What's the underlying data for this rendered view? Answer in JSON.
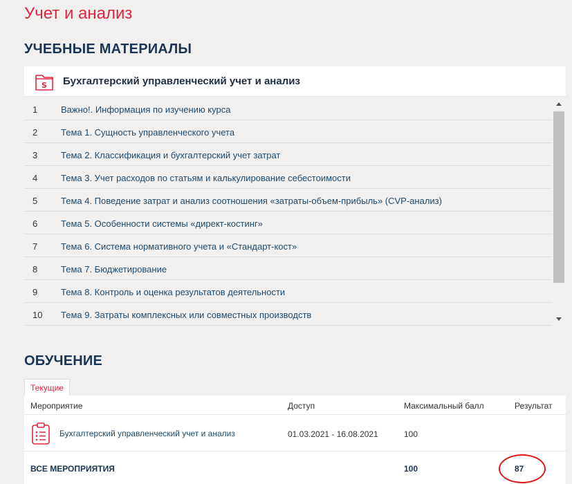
{
  "page_title": "Учет и анализ",
  "materials": {
    "heading": "УЧЕБНЫЕ МАТЕРИАЛЫ",
    "course_name": "Бухгалтерский управленческий учет и анализ",
    "topics": [
      {
        "num": "1",
        "title": "Важно!. Информация по изучению курса"
      },
      {
        "num": "2",
        "title": "Тема 1. Сущность управленческого учета"
      },
      {
        "num": "3",
        "title": "Тема 2. Классификация и бухгалтерский учет затрат"
      },
      {
        "num": "4",
        "title": "Тема 3. Учет расходов по статьям и калькулирование себестоимости"
      },
      {
        "num": "5",
        "title": "Тема 4. Поведение затрат и анализ соотношения «затраты-объем-прибыль» (CVP-анализ)"
      },
      {
        "num": "6",
        "title": "Тема 5. Особенности системы «директ-костинг»"
      },
      {
        "num": "7",
        "title": "Тема 6. Система нормативного учета и «Стандарт-кост»"
      },
      {
        "num": "8",
        "title": "Тема 7. Бюджетирование"
      },
      {
        "num": "9",
        "title": "Тема 8. Контроль и оценка результатов деятельности"
      },
      {
        "num": "10",
        "title": "Тема 9. Затраты комплексных или совместных производств"
      }
    ]
  },
  "learning": {
    "heading": "ОБУЧЕНИЕ",
    "tab_current": "Текущие",
    "columns": {
      "event": "Мероприятие",
      "access": "Доступ",
      "max_score": "Максимальный балл",
      "result": "Результат"
    },
    "row": {
      "event": "Бухгалтерский управленческий учет и анализ",
      "access": "01.03.2021 - 16.08.2021",
      "max_score": "100"
    },
    "total": {
      "label": "ВСЕ МЕРОПРИЯТИЯ",
      "max_score": "100",
      "result": "87"
    }
  },
  "colors": {
    "accent": "#e0263d",
    "heading": "#1a3553",
    "link": "#1e4a6e",
    "highlight_circle": "#e01818"
  },
  "icons": {
    "course": "folder-s-icon",
    "event": "clipboard-list-icon"
  }
}
